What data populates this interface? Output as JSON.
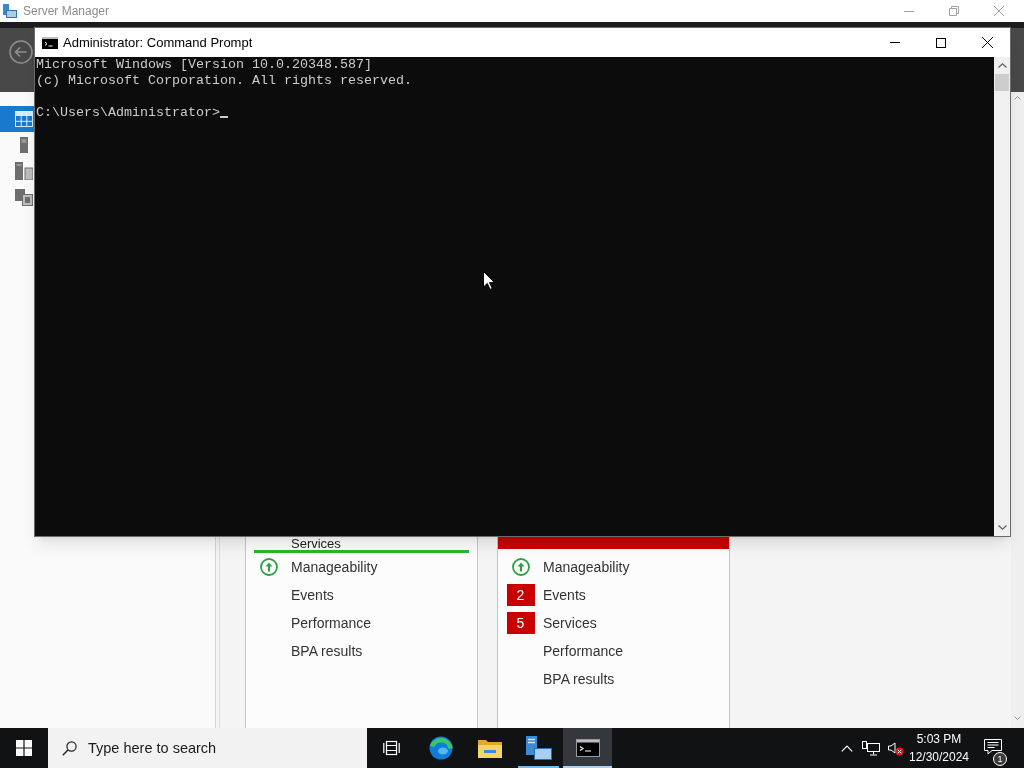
{
  "server_manager": {
    "title": "Server Manager",
    "nav_items": [
      {
        "selected": true
      },
      {
        "selected": false
      },
      {
        "selected": false
      },
      {
        "selected": false
      }
    ],
    "tiles": [
      {
        "healthy": true,
        "title": "Services",
        "rows": [
          {
            "kind": "ok",
            "label": "Manageability"
          },
          {
            "kind": "plain",
            "label": "Events"
          },
          {
            "kind": "plain",
            "label": "Performance"
          },
          {
            "kind": "plain",
            "label": "BPA results"
          }
        ]
      },
      {
        "healthy": false,
        "rows": [
          {
            "kind": "ok",
            "label": "Manageability"
          },
          {
            "kind": "alert",
            "count": "2",
            "label": "Events"
          },
          {
            "kind": "alert",
            "count": "5",
            "label": "Services"
          },
          {
            "kind": "plain",
            "label": "Performance"
          },
          {
            "kind": "plain",
            "label": "BPA results"
          }
        ]
      }
    ]
  },
  "command_prompt": {
    "title": "Administrator: Command Prompt",
    "output": [
      "Microsoft Windows [Version 10.0.20348.587]",
      "(c) Microsoft Corporation. All rights reserved."
    ],
    "prompt": "C:\\Users\\Administrator>"
  },
  "taskbar": {
    "search": {
      "placeholder": "Type here to search"
    },
    "apps": [
      {
        "running": false,
        "selected": false
      },
      {
        "running": false,
        "selected": false
      },
      {
        "running": true,
        "selected": false
      },
      {
        "running": true,
        "selected": true
      }
    ],
    "clock": {
      "time": "5:03 PM",
      "date": "12/30/2024"
    },
    "notifications": {
      "count": "1"
    }
  }
}
